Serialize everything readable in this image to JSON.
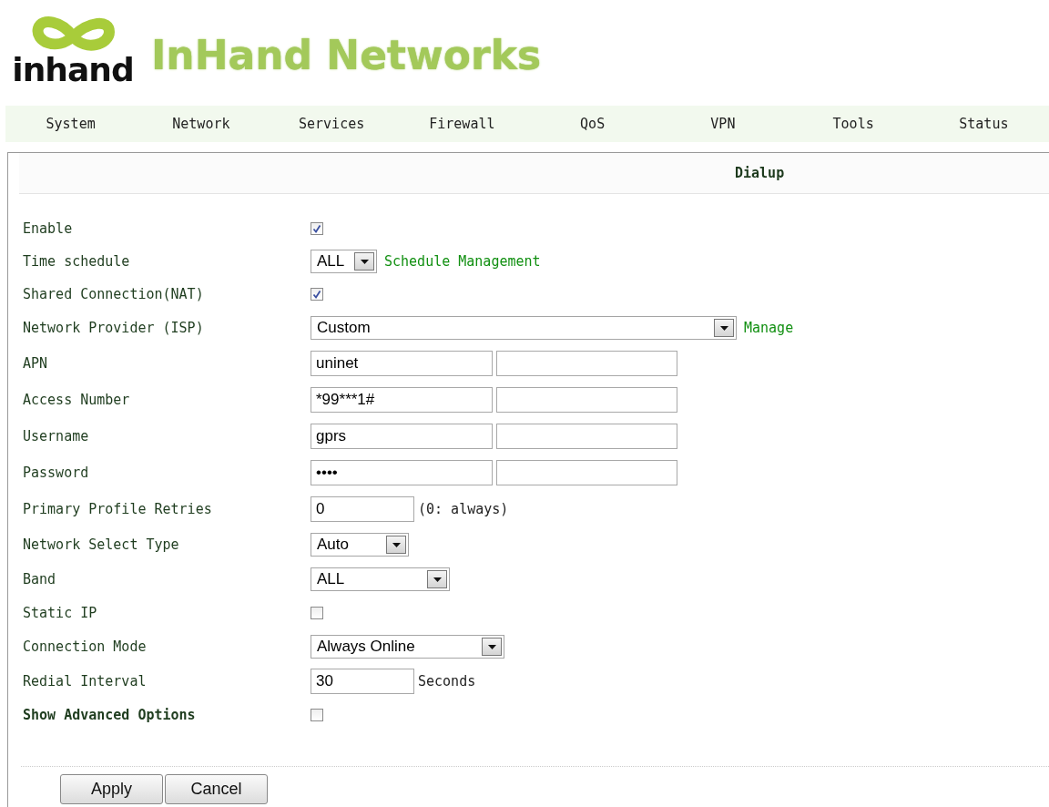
{
  "header": {
    "logo_text": "inhand",
    "brand": "InHand Networks"
  },
  "nav": [
    {
      "label": "System"
    },
    {
      "label": "Network"
    },
    {
      "label": "Services"
    },
    {
      "label": "Firewall"
    },
    {
      "label": "QoS"
    },
    {
      "label": "VPN"
    },
    {
      "label": "Tools"
    },
    {
      "label": "Status"
    }
  ],
  "panel": {
    "title": "Dialup",
    "rows": [
      {
        "kind": "checkbox",
        "label": "Enable",
        "checked": true
      },
      {
        "kind": "select",
        "label": "Time schedule",
        "value": "ALL",
        "link": "Schedule Management"
      },
      {
        "kind": "checkbox",
        "label": "Shared Connection(NAT)",
        "checked": true
      },
      {
        "kind": "select",
        "label": "Network Provider (ISP)",
        "value": "Custom",
        "link": "Manage"
      },
      {
        "kind": "pair",
        "label": "APN",
        "value": "uninet"
      },
      {
        "kind": "pair",
        "label": "Access Number",
        "value": "*99***1#"
      },
      {
        "kind": "pair",
        "label": "Username",
        "value": "gprs"
      },
      {
        "kind": "pair",
        "label": "Password",
        "value": "••••"
      },
      {
        "kind": "text",
        "label": "Primary Profile Retries",
        "value": "0",
        "note": "(0: always)"
      },
      {
        "kind": "select",
        "label": "Network Select Type",
        "value": "Auto"
      },
      {
        "kind": "select",
        "label": "Band",
        "value": "ALL"
      },
      {
        "kind": "checkbox",
        "label": "Static IP",
        "checked": false
      },
      {
        "kind": "select",
        "label": "Connection Mode",
        "value": "Always Online"
      },
      {
        "kind": "text",
        "label": "Redial Interval",
        "value": "30",
        "note": "Seconds"
      },
      {
        "kind": "checkbox",
        "label": "Show Advanced Options",
        "checked": false,
        "bold": true
      }
    ]
  },
  "buttons": [
    {
      "label": "Apply"
    },
    {
      "label": "Cancel"
    }
  ]
}
